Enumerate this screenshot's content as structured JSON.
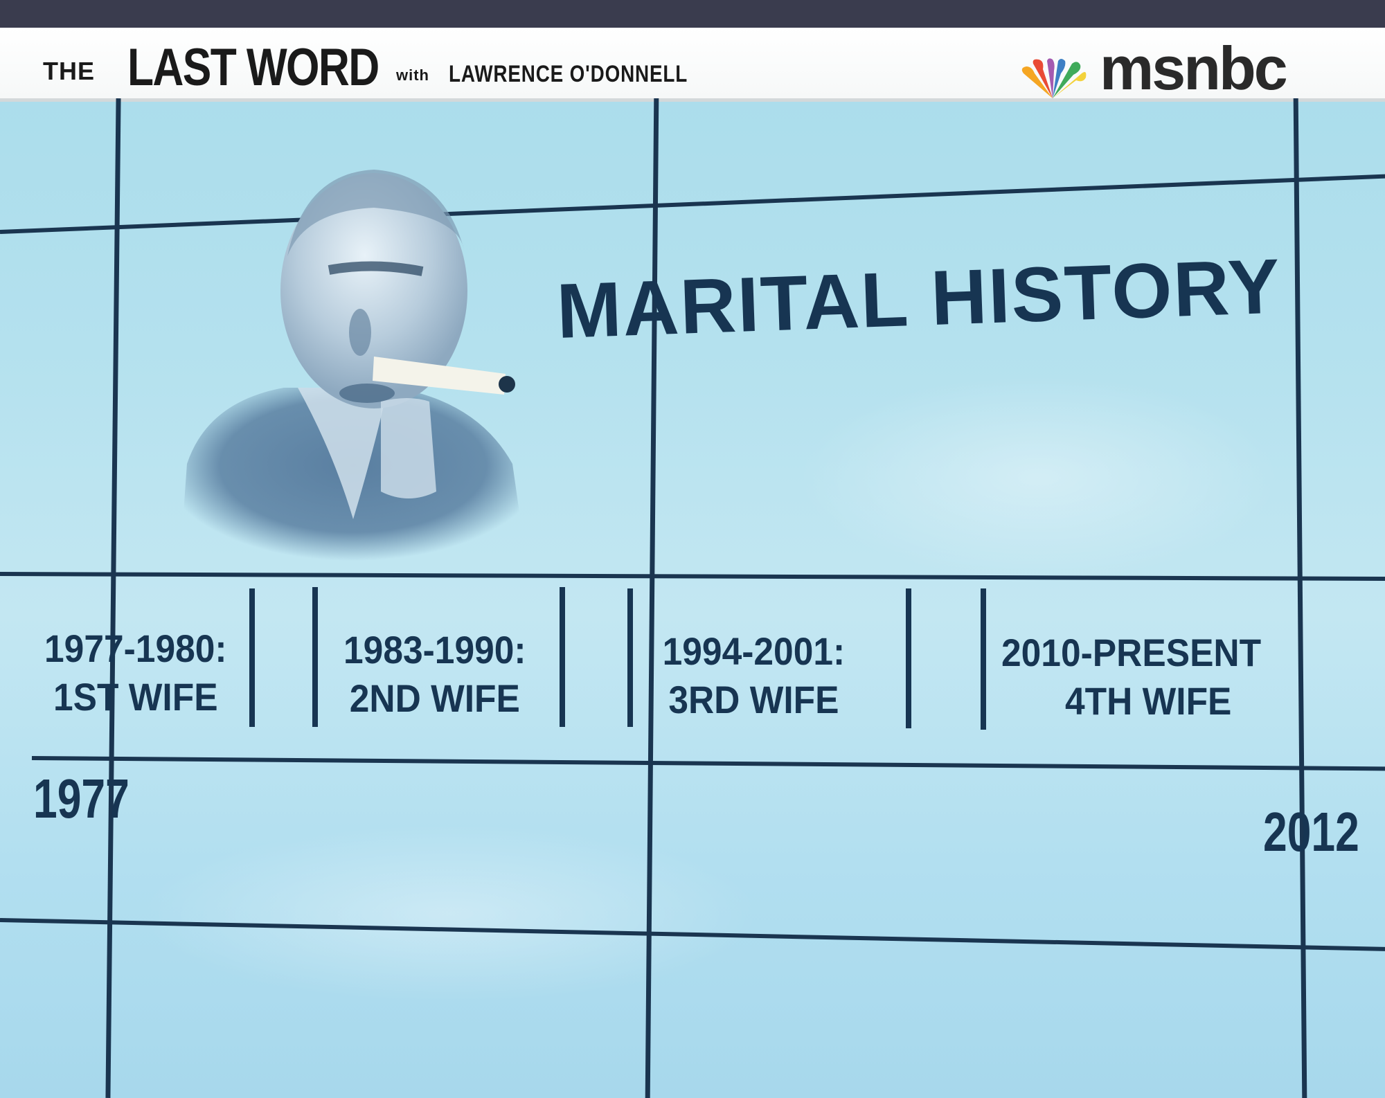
{
  "show": {
    "title_the": "THE",
    "title_main": "LAST WORD",
    "title_with": "with",
    "title_host": "LAWRENCE O'DONNELL",
    "network": "msnbc"
  },
  "graphic": {
    "headline": "MARITAL HISTORY",
    "periods": [
      {
        "range": "1977-1980:",
        "label": "1ST WIFE"
      },
      {
        "range": "1983-1990:",
        "label": "2ND WIFE"
      },
      {
        "range": "1994-2001:",
        "label": "3RD WIFE"
      },
      {
        "range": "2010-PRESENT",
        "label": "4TH WIFE"
      }
    ],
    "start_year": "1977",
    "end_year": "2012"
  },
  "colors": {
    "screen": "#b8e3f0",
    "ink": "#173552",
    "frame_line": "#1a3550",
    "banner": "#ffffff"
  }
}
